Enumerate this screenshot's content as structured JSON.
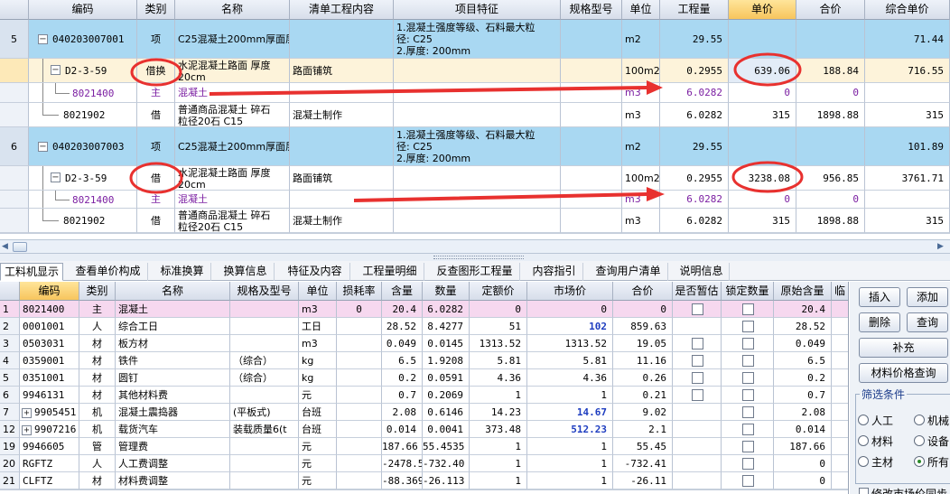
{
  "upper_grid": {
    "headers": [
      "编码",
      "类别",
      "名称",
      "清单工程内容",
      "项目特征",
      "规格型号",
      "单位",
      "工程量",
      "单价",
      "合价",
      "综合单价"
    ],
    "rows": [
      {
        "rownum": "5",
        "code": "040203007001",
        "type": "项",
        "name": "C25混凝土200mm厚面层",
        "content": "",
        "feature1": "1.混凝土强度等级、石料最大粒",
        "feature2": "径:  C25",
        "feature3": "2.厚度:  200mm",
        "unit": "m2",
        "qty": "29.55",
        "price": "",
        "total": "",
        "unit_price": "71.44"
      },
      {
        "rownum": "",
        "code": "D2-3-59",
        "type": "借换",
        "name1": "水泥混凝土路面 厚度",
        "name2": "20cm",
        "content": "路面铺筑",
        "unit": "100m2",
        "qty": "0.2955",
        "price": "639.06",
        "total": "188.84",
        "unit_price": "716.55"
      },
      {
        "rownum": "",
        "code": "8021400",
        "type": "主",
        "name": "混凝土",
        "unit": "m3",
        "qty": "6.0282",
        "price": "0",
        "total": "0",
        "unit_price": ""
      },
      {
        "rownum": "",
        "code": "8021902",
        "type": "借",
        "name1": "普通商品混凝土 碎石",
        "name2": "粒径20石 C15",
        "content": "混凝土制作",
        "unit": "m3",
        "qty": "6.0282",
        "price": "315",
        "total": "1898.88",
        "unit_price": "315"
      },
      {
        "rownum": "6",
        "code": "040203007003",
        "type": "项",
        "name": "C25混凝土200mm厚面层",
        "content": "",
        "feature1": "1.混凝土强度等级、石料最大粒",
        "feature2": "径:  C25",
        "feature3": "2.厚度:  200mm",
        "unit": "m2",
        "qty": "29.55",
        "price": "",
        "total": "",
        "unit_price": "101.89"
      },
      {
        "rownum": "",
        "code": "D2-3-59",
        "type": "借",
        "name1": "水泥混凝土路面 厚度",
        "name2": "20cm",
        "content": "路面铺筑",
        "unit": "100m2",
        "qty": "0.2955",
        "price": "3238.08",
        "total": "956.85",
        "unit_price": "3761.71"
      },
      {
        "rownum": "",
        "code": "8021400",
        "type": "主",
        "name": "混凝土",
        "unit": "m3",
        "qty": "6.0282",
        "price": "0",
        "total": "0",
        "unit_price": ""
      },
      {
        "rownum": "",
        "code": "8021902",
        "type": "借",
        "name1": "普通商品混凝土 碎石",
        "name2": "粒径20石 C15",
        "content": "混凝土制作",
        "unit": "m3",
        "qty": "6.0282",
        "price": "315",
        "total": "1898.88",
        "unit_price": "315"
      }
    ]
  },
  "tabs": [
    "工料机显示",
    "查看单价构成",
    "标准换算",
    "换算信息",
    "特征及内容",
    "工程量明细",
    "反查图形工程量",
    "内容指引",
    "查询用户清单",
    "说明信息"
  ],
  "lower_grid": {
    "headers": [
      "编码",
      "类别",
      "名称",
      "规格及型号",
      "单位",
      "损耗率",
      "含量",
      "数量",
      "定额价",
      "市场价",
      "合价",
      "是否暂估",
      "锁定数量",
      "原始含量",
      "临"
    ],
    "rows": [
      {
        "idx": "1",
        "code": "8021400",
        "type": "主",
        "name": "混凝土",
        "spec": "",
        "unit": "m3",
        "loss": "0",
        "content": "20.4",
        "qty": "6.0282",
        "quota": "0",
        "market": "0",
        "total": "0",
        "orig": "20.4"
      },
      {
        "idx": "2",
        "code": "0001001",
        "type": "人",
        "name": "综合工日",
        "spec": "",
        "unit": "工日",
        "loss": "",
        "content": "28.52",
        "qty": "8.4277",
        "quota": "51",
        "market": "102",
        "total": "859.63",
        "orig": "28.52"
      },
      {
        "idx": "3",
        "code": "0503031",
        "type": "材",
        "name": "板方材",
        "spec": "",
        "unit": "m3",
        "loss": "",
        "content": "0.049",
        "qty": "0.0145",
        "quota": "1313.52",
        "market": "1313.52",
        "total": "19.05",
        "orig": "0.049"
      },
      {
        "idx": "4",
        "code": "0359001",
        "type": "材",
        "name": "铁件",
        "spec": "（综合）",
        "unit": "kg",
        "loss": "",
        "content": "6.5",
        "qty": "1.9208",
        "quota": "5.81",
        "market": "5.81",
        "total": "11.16",
        "orig": "6.5"
      },
      {
        "idx": "5",
        "code": "0351001",
        "type": "材",
        "name": "圆钉",
        "spec": "（综合）",
        "unit": "kg",
        "loss": "",
        "content": "0.2",
        "qty": "0.0591",
        "quota": "4.36",
        "market": "4.36",
        "total": "0.26",
        "orig": "0.2"
      },
      {
        "idx": "6",
        "code": "9946131",
        "type": "材",
        "name": "其他材料费",
        "spec": "",
        "unit": "元",
        "loss": "",
        "content": "0.7",
        "qty": "0.2069",
        "quota": "1",
        "market": "1",
        "total": "0.21",
        "orig": "0.7"
      },
      {
        "idx": "7",
        "code": "9905451",
        "type": "机",
        "name": "混凝土震捣器",
        "spec": "(平板式)",
        "unit": "台班",
        "loss": "",
        "content": "2.08",
        "qty": "0.6146",
        "quota": "14.23",
        "market": "14.67",
        "total": "9.02",
        "orig": "2.08"
      },
      {
        "idx": "12",
        "code": "9907216",
        "type": "机",
        "name": "载货汽车",
        "spec": "装载质量6(t",
        "unit": "台班",
        "loss": "",
        "content": "0.014",
        "qty": "0.0041",
        "quota": "373.48",
        "market": "512.23",
        "total": "2.1",
        "orig": "0.014"
      },
      {
        "idx": "19",
        "code": "9946605",
        "type": "管",
        "name": "管理费",
        "spec": "",
        "unit": "元",
        "loss": "",
        "content": "187.66",
        "qty": "55.4535",
        "quota": "1",
        "market": "1",
        "total": "55.45",
        "orig": "187.66"
      },
      {
        "idx": "20",
        "code": "RGFTZ",
        "type": "人",
        "name": "人工费调整",
        "spec": "",
        "unit": "元",
        "loss": "",
        "content": "-2478.5",
        "qty": "-732.40",
        "quota": "1",
        "market": "1",
        "total": "-732.41",
        "orig": "0"
      },
      {
        "idx": "21",
        "code": "CLFTZ",
        "type": "材",
        "name": "材料费调整",
        "spec": "",
        "unit": "元",
        "loss": "",
        "content": "-88.369",
        "qty": "-26.113",
        "quota": "1",
        "market": "1",
        "total": "-26.11",
        "orig": "0"
      }
    ]
  },
  "side_panel": {
    "insert": "插入",
    "add": "添加",
    "delete": "删除",
    "query": "查询",
    "supplement": "补充",
    "material_price_query": "材料价格查询",
    "filter_title": "筛选条件",
    "filters": [
      "人工",
      "机械",
      "材料",
      "设备",
      "主材",
      "所有"
    ],
    "bottom_text": "修改市场价同步"
  },
  "colors": {
    "item_row": "#a9d8f2",
    "selected_row": "#fdf3da",
    "highlight_header": "#f7c55d",
    "annotation_red": "#e8312f"
  }
}
